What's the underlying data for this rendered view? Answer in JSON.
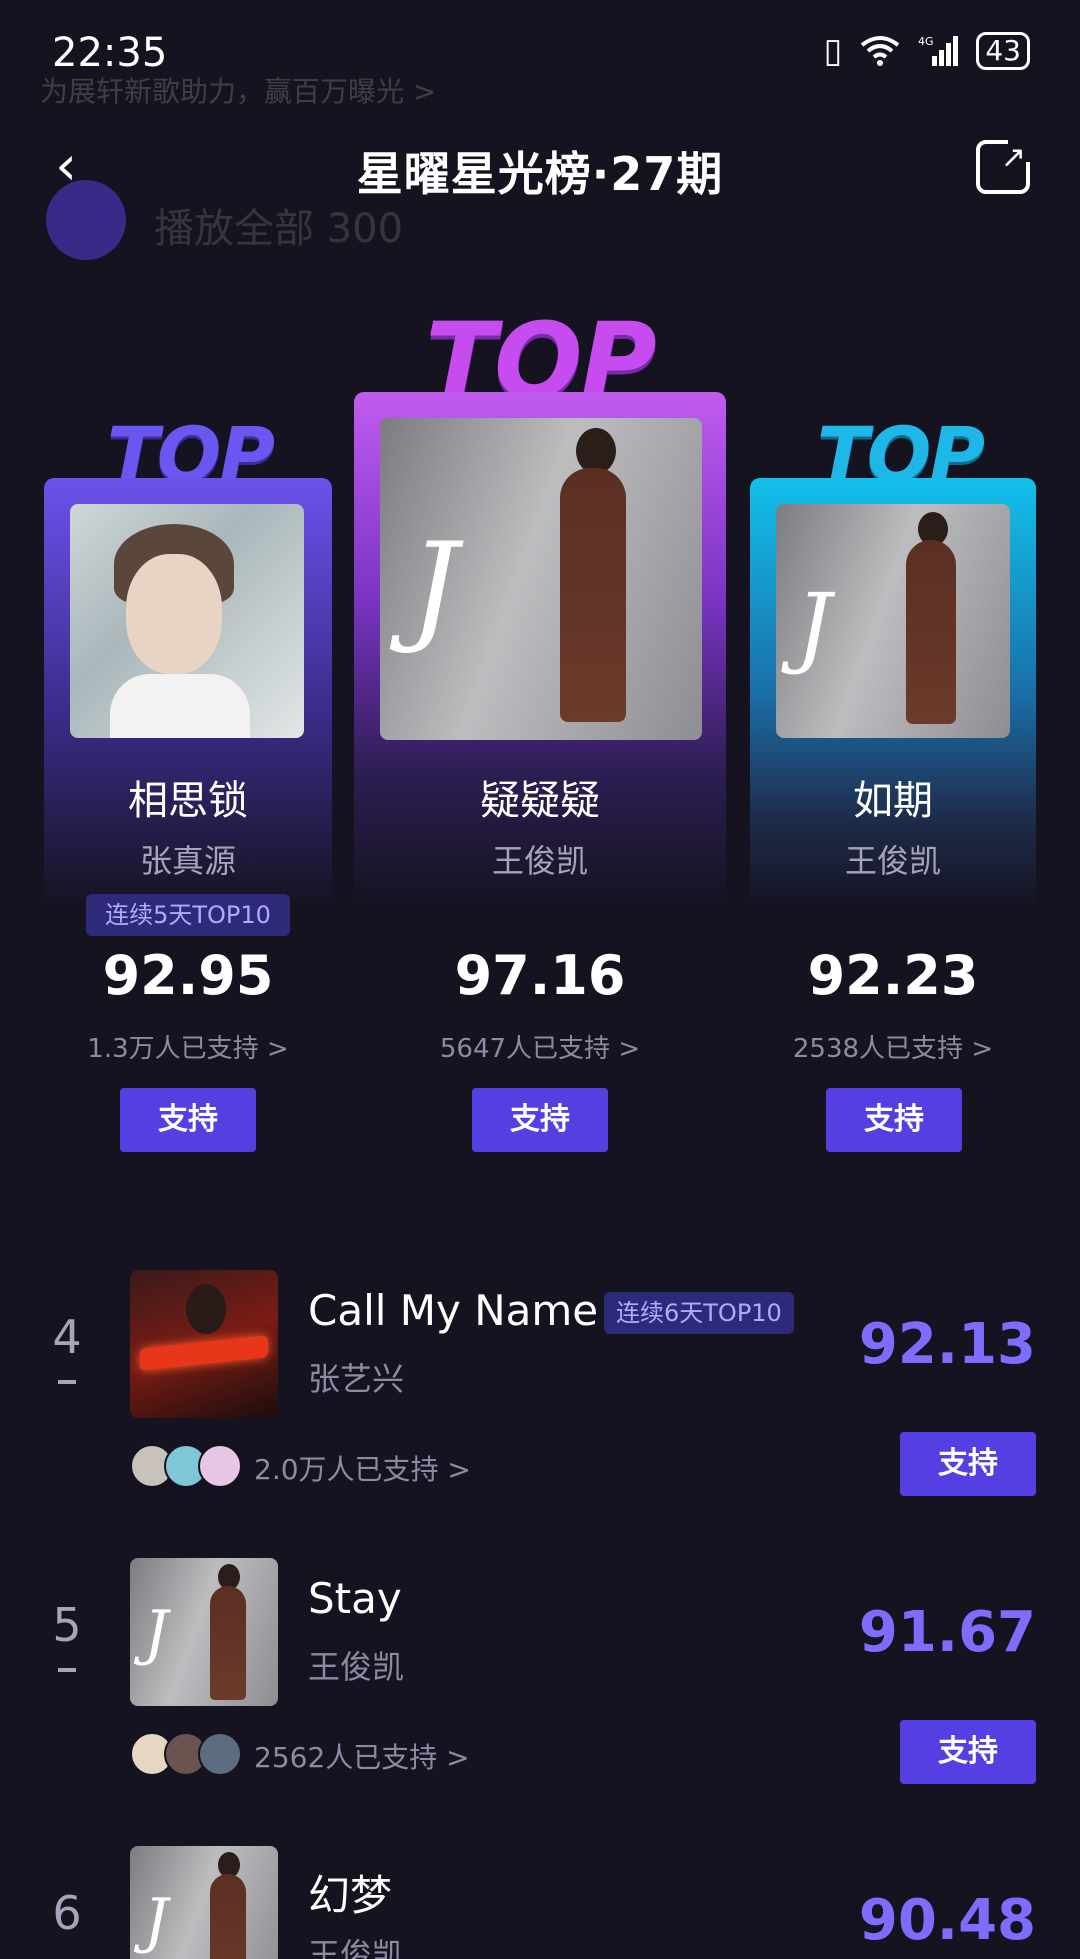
{
  "status_bar": {
    "time": "22:35",
    "battery": "43",
    "network": "4G"
  },
  "background_banner": {
    "text": "为展轩新歌助力，赢百万曝光 >",
    "play_all": "播放全部 300"
  },
  "header": {
    "title": "星曜星光榜·27期"
  },
  "podium": [
    {
      "rank_label": "TOP 1",
      "title": "疑疑疑",
      "artist": "王俊凯",
      "score": "97.16",
      "supporters": "5647人已支持 >",
      "support_label": "支持"
    },
    {
      "rank_label": "TOP 2",
      "title": "相思锁",
      "artist": "张真源",
      "streak": "连续5天TOP10",
      "score": "92.95",
      "supporters": "1.3万人已支持 >",
      "support_label": "支持"
    },
    {
      "rank_label": "TOP 3",
      "title": "如期",
      "artist": "王俊凯",
      "score": "92.23",
      "supporters": "2538人已支持 >",
      "support_label": "支持"
    }
  ],
  "list": [
    {
      "rank": "4",
      "title": "Call My Name",
      "artist": "张艺兴",
      "streak": "连续6天TOP10",
      "score": "92.13",
      "supporters": "2.0万人已支持 >",
      "support_label": "支持"
    },
    {
      "rank": "5",
      "title": "Stay",
      "artist": "王俊凯",
      "score": "91.67",
      "supporters": "2562人已支持 >",
      "support_label": "支持"
    },
    {
      "rank": "6",
      "title": "幻梦",
      "artist": "王俊凯",
      "score": "90.48"
    }
  ],
  "colors": {
    "background": "#15131f",
    "accent": "#5440e2",
    "score_purple": "#7e6cff",
    "top1": "#c74cf0",
    "top2": "#6a56f0",
    "top3": "#1fb6e8"
  },
  "icons": {
    "back": "chevron-left-icon",
    "share": "share-icon",
    "vibrate": "vibrate-icon",
    "wifi": "wifi-icon",
    "signal": "signal-icon",
    "battery": "battery-icon"
  }
}
